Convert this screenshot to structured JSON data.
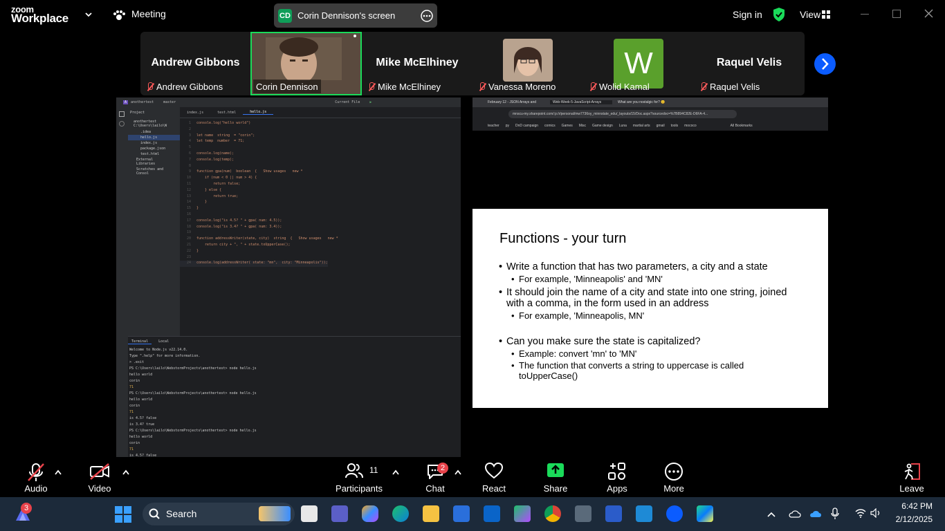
{
  "zoom": {
    "logo_line1": "zoom",
    "logo_line2": "Workplace",
    "meeting_label": "Meeting",
    "screen_initials": "CD",
    "screen_label": "Corin Dennison's screen",
    "sign_in": "Sign in",
    "view": "View"
  },
  "participants": [
    {
      "big": "Andrew Gibbons",
      "tag": "Andrew Gibbons",
      "muted": true
    },
    {
      "big": "",
      "tag": "Corin Dennison",
      "muted": false,
      "active": true
    },
    {
      "big": "Mike McElhiney",
      "tag": "Mike McElhiney",
      "muted": true
    },
    {
      "big": "",
      "tag": "Vanessa Moreno",
      "muted": true
    },
    {
      "big": "W",
      "tag": "Wolid Kamal",
      "muted": true
    },
    {
      "big": "Raquel Velis",
      "tag": "Raquel Velis",
      "muted": true
    }
  ],
  "ide": {
    "project": "anothertest",
    "branch": "master",
    "current_file": "Current File",
    "project_label": "Project",
    "tabs": [
      "index.js",
      "test.html",
      "hello.js"
    ],
    "tree": [
      "anothertest  C:\\Users\\lailo\\W",
      ".idea",
      "hello.js",
      "index.js",
      "package.json",
      "test.html",
      "External Libraries",
      "Scratches and Consol"
    ],
    "code_lines": [
      {
        "n": "1",
        "t": "console.log(\"hello world\")"
      },
      {
        "n": "2",
        "t": ""
      },
      {
        "n": "3",
        "t": "let name  string  = \"corin\";"
      },
      {
        "n": "4",
        "t": "let temp  number  = 71;"
      },
      {
        "n": "5",
        "t": ""
      },
      {
        "n": "6",
        "t": "console.log(name);"
      },
      {
        "n": "7",
        "t": "console.log(temp);"
      },
      {
        "n": "8",
        "t": ""
      },
      {
        "n": "9",
        "t": "function gpa(num)  boolean  {   Show usages   new *"
      },
      {
        "n": "10",
        "t": "    if (num < 0 || num > 4) {"
      },
      {
        "n": "11",
        "t": "        return false;"
      },
      {
        "n": "12",
        "t": "    } else {"
      },
      {
        "n": "13",
        "t": "        return true;"
      },
      {
        "n": "14",
        "t": "    }"
      },
      {
        "n": "15",
        "t": "}"
      },
      {
        "n": "16",
        "t": ""
      },
      {
        "n": "17",
        "t": "console.log(\"is 4.5? \" + gpa( num: 4.5));"
      },
      {
        "n": "18",
        "t": "console.log(\"is 3.4? \" + gpa( num: 3.4));"
      },
      {
        "n": "19",
        "t": ""
      },
      {
        "n": "20",
        "t": "function addressWriter(state, city)  string  {   Show usages   new *"
      },
      {
        "n": "21",
        "t": "    return city + \", \" + state.toUpperCase();"
      },
      {
        "n": "22",
        "t": "}"
      },
      {
        "n": "23",
        "t": ""
      },
      {
        "n": "24",
        "t": "console.log(addressWriter( state: \"mn\",  city: \"Minneapolis\"));"
      }
    ],
    "terminal_tabs": [
      "Terminal",
      "Local"
    ],
    "terminal_lines": [
      "Welcome to Node.js v22.14.0.",
      "Type \".help\" for more information.",
      "> .exit",
      "PS C:\\Users\\lailo\\WebstormProjects\\anothertest> node hello.js",
      "hello world",
      "corin",
      "71",
      "PS C:\\Users\\lailo\\WebstormProjects\\anothertest> node hello.js",
      "hello world",
      "corin",
      "71",
      "is 4.5? false",
      "is 3.4? true",
      "PS C:\\Users\\lailo\\WebstormProjects\\anothertest> node hello.js",
      "hello world",
      "corin",
      "71",
      "is 4.5? false"
    ]
  },
  "browser": {
    "tabs": [
      "February 12 - JSON Arrays and",
      "Web-Week-5-JavaScript-Arrays",
      "What are you nostalgic for? 😊"
    ],
    "url": "mnscu-my.sharepoint.com/:p:/r/personal/mw7736oy_minnstate_edu/_layouts/15/Doc.aspx?sourcedoc=%7B894C82E-D6FA-4...",
    "bookmarks": [
      "teacher",
      "py",
      "DnD campaign",
      "comics",
      "Games",
      "Misc",
      "Game design",
      "Luna",
      "martial arts",
      "gmail",
      "tools",
      "mococo",
      "All Bookmarks"
    ]
  },
  "slide": {
    "title": "Functions - your turn",
    "bullets": [
      {
        "level": 1,
        "text": "Write a function that has two parameters, a city and a state"
      },
      {
        "level": 2,
        "text": "For example, 'Minneapolis' and 'MN'"
      },
      {
        "level": 1,
        "text": "It should join the name of a city and state into one string, joined with a comma, in the form used in an address"
      },
      {
        "level": 2,
        "text": "For example, 'Minneapolis, MN'"
      },
      {
        "level": 1,
        "text": "Can you make sure the state is capitalized?"
      },
      {
        "level": 2,
        "text": "Example: convert 'mn' to 'MN'"
      },
      {
        "level": 2,
        "text": "The function that converts a string to uppercase is called toUpperCase()"
      }
    ]
  },
  "toolbar": {
    "audio": "Audio",
    "video": "Video",
    "participants": "Participants",
    "participants_count": "11",
    "chat": "Chat",
    "chat_badge": "2",
    "react": "React",
    "share": "Share",
    "apps": "Apps",
    "more": "More",
    "leave": "Leave"
  },
  "taskbar": {
    "search": "Search",
    "notification_count": "3",
    "time": "6:42 PM",
    "date": "2/12/2025"
  },
  "colors": {
    "zoom_green": "#0f9d58",
    "share_green": "#1adb5a",
    "muted_red": "#ff5a5a",
    "leave_red": "#e8424a",
    "blue_arrow": "#0b5cff"
  }
}
